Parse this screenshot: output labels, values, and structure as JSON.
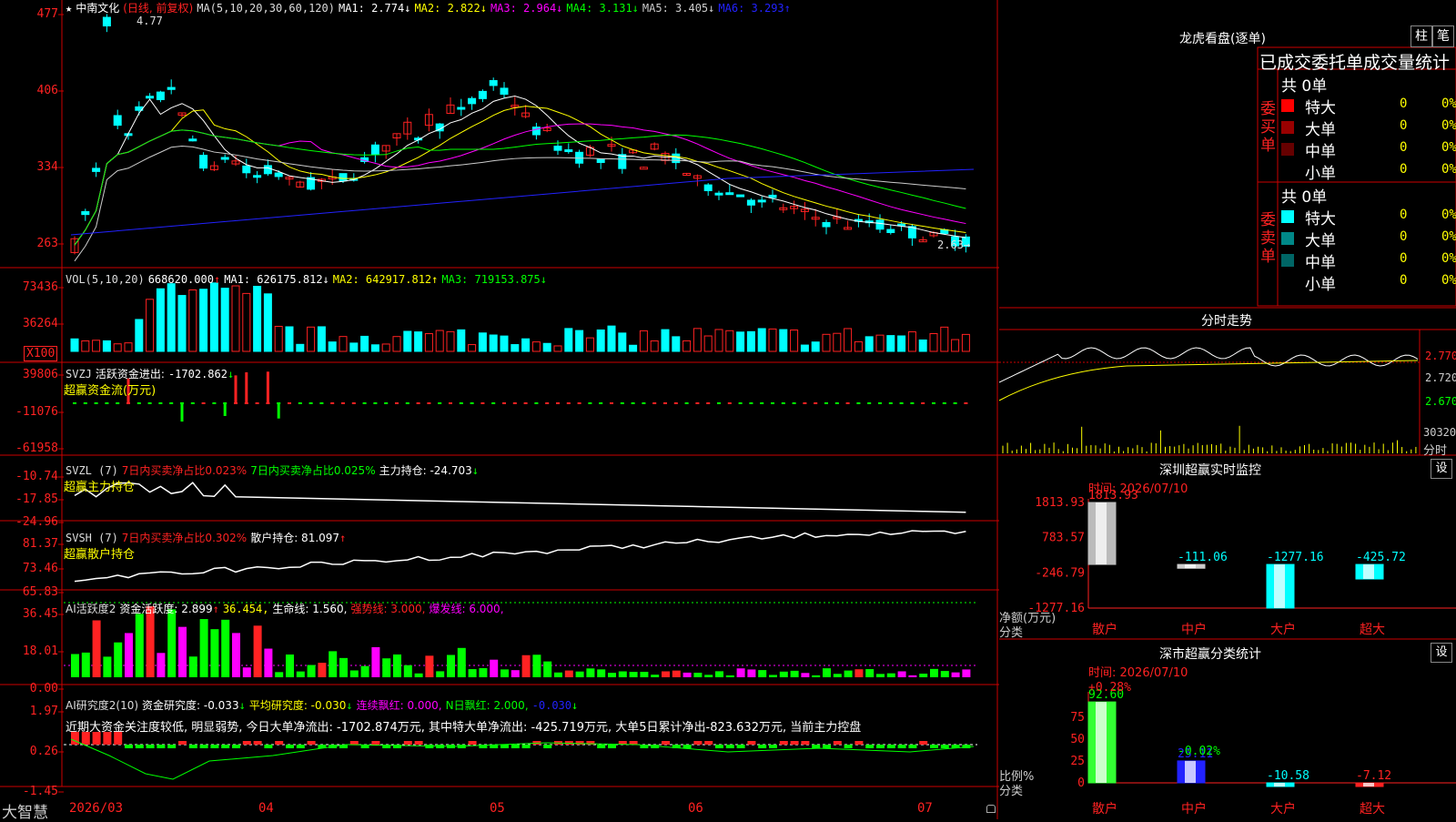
{
  "app": {
    "brand": "大智慧"
  },
  "stock": {
    "name": "中南文化",
    "qualifier": "(日线, 前复权)"
  },
  "main_panel": {
    "ma_header": "MA(5,10,20,30,60,120)",
    "ma": [
      {
        "label": "MA1:",
        "value": "2.774",
        "arrow": "↓",
        "color": "#ffffff"
      },
      {
        "label": "MA2:",
        "value": "2.822",
        "arrow": "↓",
        "color": "#ffff00"
      },
      {
        "label": "MA3:",
        "value": "2.964",
        "arrow": "↓",
        "color": "#ff00ff"
      },
      {
        "label": "MA4:",
        "value": "3.131",
        "arrow": "↓",
        "color": "#00ff00"
      },
      {
        "label": "MA5:",
        "value": "3.405",
        "arrow": "↓",
        "color": "#cccccc"
      },
      {
        "label": "MA6:",
        "value": "3.293",
        "arrow": "↑",
        "color": "#2222ff"
      }
    ],
    "yticks": [
      "477",
      "406",
      "334",
      "263"
    ],
    "high_mark": "4.77",
    "low_mark": "2.63→"
  },
  "vol_panel": {
    "header": "VOL(5,10,20)",
    "value": "668620.000",
    "value_arrow": "↑",
    "ma": [
      {
        "label": "MA1:",
        "value": "626175.812",
        "arrow": "↓",
        "color": "#ffffff"
      },
      {
        "label": "MA2:",
        "value": "642917.812",
        "arrow": "↑",
        "color": "#ffff00"
      },
      {
        "label": "MA3:",
        "value": "719153.875",
        "arrow": "↓",
        "color": "#00ff00"
      }
    ],
    "yticks": [
      "73436",
      "36264"
    ],
    "unit": "X100"
  },
  "svzj_panel": {
    "header": "SVZJ",
    "label": "活跃资金进出:",
    "value": "-1702.862",
    "arrow": "↓",
    "sub": "超赢资金流(万元)",
    "yticks": [
      "39806",
      "-11076",
      "-61958"
    ]
  },
  "svzl_panel": {
    "header": "SVZL (7)",
    "l1": "7日内买卖净占比0.023%",
    "l2": "7日内买卖净占比0.025%",
    "l3": "主力持仓: -24.703",
    "arrow": "↓",
    "sub": "超赢主力持仓",
    "yticks": [
      "-10.74",
      "-17.85",
      "-24.96"
    ]
  },
  "svsh_panel": {
    "header": "SVSH (7)",
    "l1": "7日内买卖净占比0.302%",
    "l2": "散户持仓: 81.097",
    "arrow": "↑",
    "sub": "超赢散户持仓",
    "yticks": [
      "81.37",
      "73.46",
      "65.83"
    ]
  },
  "ai_active_panel": {
    "header": "AI活跃度2",
    "l1": "资金活跃度: 2.899",
    "a1": "↑",
    "l2": "36.454,",
    "l3": "生命线: 1.560,",
    "l4": "强势线: 3.000,",
    "l5": "爆发线: 6.000,",
    "yticks": [
      "36.45",
      "18.01",
      "0.00"
    ]
  },
  "ai_research_panel": {
    "header": "AI研究度2(10)",
    "l1": "资金研究度: -0.033",
    "a1": "↓",
    "l2": "平均研究度: -0.030",
    "a2": "↓",
    "l3": "连续飘红: 0.000,",
    "l4": "N日飘红: 2.000,",
    "l5": "-0.030",
    "a5": "↓",
    "comment": "近期大资金关注度较低, 明显弱势, 今日大单净流出: -1702.874万元, 其中特大单净流出: -425.719万元, 大单5日累计净出-823.632万元, 当前主力控盘",
    "yticks": [
      "1.97",
      "0.26",
      "-1.45"
    ]
  },
  "xaxis": {
    "labels": [
      "2026/03",
      "04",
      "05",
      "06",
      "07"
    ]
  },
  "longhu": {
    "title": "龙虎看盘(逐单)",
    "btn_bar": "柱",
    "btn_pen": "笔",
    "tab_title": "已成交委托单成交量统计",
    "buy": {
      "side_label": "委买单",
      "total": "共 0单",
      "rows": [
        {
          "name": "特大",
          "count": "0",
          "pct": "0%",
          "color": "#ff0000"
        },
        {
          "name": "大单",
          "count": "0",
          "pct": "0%",
          "color": "#990000"
        },
        {
          "name": "中单",
          "count": "0",
          "pct": "0%",
          "color": "#660000"
        },
        {
          "name": "小单",
          "count": "0",
          "pct": "0%",
          "color": ""
        }
      ]
    },
    "sell": {
      "side_label": "委卖单",
      "total": "共 0单",
      "rows": [
        {
          "name": "特大",
          "count": "0",
          "pct": "0%",
          "color": "#00ffff"
        },
        {
          "name": "大单",
          "count": "0",
          "pct": "0%",
          "color": "#008888"
        },
        {
          "name": "中单",
          "count": "0",
          "pct": "0%",
          "color": "#006666"
        },
        {
          "name": "小单",
          "count": "0",
          "pct": "0%",
          "color": ""
        }
      ]
    }
  },
  "intraday": {
    "title": "分时走势",
    "prices": [
      "2.770",
      "2.720",
      "2.670"
    ],
    "vol": "30320",
    "vol_unit": "分时"
  },
  "sz_monitor": {
    "title": "深圳超赢实时监控",
    "btn": "设",
    "time_label": "时间: 2026/07/10",
    "yticks": [
      "1813.93",
      "783.57",
      "-246.79",
      "-1277.16"
    ],
    "ylabel1": "净额(万元)",
    "ylabel2": "分类",
    "chart_data": {
      "type": "bar",
      "categories": [
        "散户",
        "中户",
        "大户",
        "超大"
      ],
      "values": [
        1813.93,
        -111.06,
        -1277.16,
        -425.72
      ],
      "value_labels": [
        "1813.93",
        "-111.06",
        "-1277.16",
        "-425.72"
      ],
      "ylim": [
        -1277.16,
        1813.93
      ]
    }
  },
  "sz_class": {
    "title": "深市超赢分类统计",
    "btn": "设",
    "time_label": "时间: 2026/07/10",
    "yticks": [
      "75",
      "50",
      "25",
      "0"
    ],
    "ylabel1": "比例%",
    "ylabel2": "分类",
    "change_labels": [
      "+0.28%",
      "-0.02%"
    ],
    "chart_data": {
      "type": "bar",
      "categories": [
        "散户",
        "中户",
        "大户",
        "超大"
      ],
      "values": [
        92.6,
        25.11,
        -10.58,
        -7.12
      ],
      "value_labels": [
        "92.60",
        "25.11",
        "-10.58",
        "-7.12"
      ],
      "ylim": [
        0,
        100
      ]
    }
  }
}
